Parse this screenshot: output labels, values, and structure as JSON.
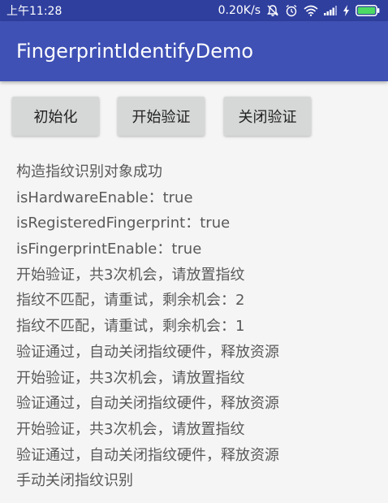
{
  "status_bar": {
    "time": "上午11:28",
    "network_speed": "0.20K/s",
    "icons": [
      "mute-bell-icon",
      "alarm-clock-icon",
      "wifi-icon",
      "cell-signal-icon",
      "charging-bolt-icon",
      "battery-icon"
    ],
    "battery_color": "#4cd964"
  },
  "app_bar": {
    "title": "FingerprintIdentifyDemo",
    "color": "#3f51b5"
  },
  "buttons": {
    "init": "初始化",
    "start": "开始验证",
    "close": "关闭验证"
  },
  "log_lines": [
    "构造指纹识别对象成功",
    "isHardwareEnable：true",
    "isRegisteredFingerprint：true",
    "isFingerprintEnable：true",
    "开始验证，共3次机会，请放置指纹",
    "指纹不匹配，请重试，剩余机会：2",
    "指纹不匹配，请重试，剩余机会：1",
    "验证通过，自动关闭指纹硬件，释放资源",
    "开始验证，共3次机会，请放置指纹",
    "验证通过，自动关闭指纹硬件，释放资源",
    "开始验证，共3次机会，请放置指纹",
    "验证通过，自动关闭指纹硬件，释放资源",
    "手动关闭指纹识别"
  ]
}
